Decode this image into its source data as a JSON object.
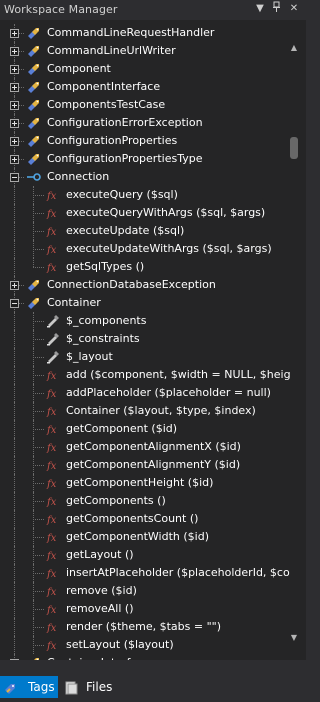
{
  "window": {
    "title": "Workspace Manager"
  },
  "title_buttons": {
    "dropdown": "▼",
    "pin": "📌",
    "close": "✕"
  },
  "tree": [
    {
      "type": "class",
      "label": "CommandLineRequestHandler",
      "expanded": false,
      "depth": 0
    },
    {
      "type": "class",
      "label": "CommandLineUrlWriter",
      "expanded": false,
      "depth": 0
    },
    {
      "type": "class",
      "label": "Component",
      "expanded": false,
      "depth": 0
    },
    {
      "type": "class",
      "label": "ComponentInterface",
      "expanded": false,
      "depth": 0
    },
    {
      "type": "class",
      "label": "ComponentsTestCase",
      "expanded": false,
      "depth": 0
    },
    {
      "type": "class",
      "label": "ConfigurationErrorException",
      "expanded": false,
      "depth": 0
    },
    {
      "type": "class",
      "label": "ConfigurationProperties",
      "expanded": false,
      "depth": 0
    },
    {
      "type": "class",
      "label": "ConfigurationPropertiesType",
      "expanded": false,
      "depth": 0
    },
    {
      "type": "interface",
      "label": "Connection",
      "expanded": true,
      "depth": 0
    },
    {
      "type": "function",
      "label": "executeQuery ($sql)",
      "depth": 1
    },
    {
      "type": "function",
      "label": "executeQueryWithArgs ($sql, $args)",
      "depth": 1
    },
    {
      "type": "function",
      "label": "executeUpdate ($sql)",
      "depth": 1
    },
    {
      "type": "function",
      "label": "executeUpdateWithArgs ($sql, $args)",
      "depth": 1
    },
    {
      "type": "function",
      "label": "getSqlTypes ()",
      "depth": 1,
      "last": true
    },
    {
      "type": "class",
      "label": "ConnectionDatabaseException",
      "expanded": false,
      "depth": 0
    },
    {
      "type": "class",
      "label": "Container",
      "expanded": true,
      "depth": 0
    },
    {
      "type": "property",
      "label": "$_components",
      "depth": 1
    },
    {
      "type": "property",
      "label": "$_constraints",
      "depth": 1
    },
    {
      "type": "property",
      "label": "$_layout",
      "depth": 1
    },
    {
      "type": "function",
      "label": "add ($component, $width = NULL, $heig",
      "depth": 1
    },
    {
      "type": "function",
      "label": "addPlaceholder ($placeholder = null)",
      "depth": 1
    },
    {
      "type": "function",
      "label": "Container ($layout, $type, $index)",
      "depth": 1
    },
    {
      "type": "function",
      "label": "getComponent ($id)",
      "depth": 1
    },
    {
      "type": "function",
      "label": "getComponentAlignmentX ($id)",
      "depth": 1
    },
    {
      "type": "function",
      "label": "getComponentAlignmentY ($id)",
      "depth": 1
    },
    {
      "type": "function",
      "label": "getComponentHeight ($id)",
      "depth": 1
    },
    {
      "type": "function",
      "label": "getComponents ()",
      "depth": 1
    },
    {
      "type": "function",
      "label": "getComponentsCount ()",
      "depth": 1
    },
    {
      "type": "function",
      "label": "getComponentWidth ($id)",
      "depth": 1
    },
    {
      "type": "function",
      "label": "getLayout ()",
      "depth": 1
    },
    {
      "type": "function",
      "label": "insertAtPlaceholder ($placeholderId, $co",
      "depth": 1
    },
    {
      "type": "function",
      "label": "remove ($id)",
      "depth": 1
    },
    {
      "type": "function",
      "label": "removeAll ()",
      "depth": 1
    },
    {
      "type": "function",
      "label": "render ($theme, $tabs = \"\")",
      "depth": 1
    },
    {
      "type": "function",
      "label": "setLayout ($layout)",
      "depth": 1
    },
    {
      "type": "class",
      "label": "ContainerInterface",
      "expanded": false,
      "depth": 0,
      "partial": true
    }
  ],
  "scrollbar": {
    "up": "▲",
    "down": "▼"
  },
  "tabs": [
    {
      "label": "Tags",
      "active": true,
      "icon": "tags-icon"
    },
    {
      "label": "Files",
      "active": false,
      "icon": "files-icon"
    }
  ],
  "colors": {
    "function_icon": "#c2524a",
    "class_icon_blue": "#5a7fd6",
    "class_icon_yellow": "#e3b341",
    "interface_icon": "#4fa3e0",
    "active_tab": "#007acc"
  }
}
